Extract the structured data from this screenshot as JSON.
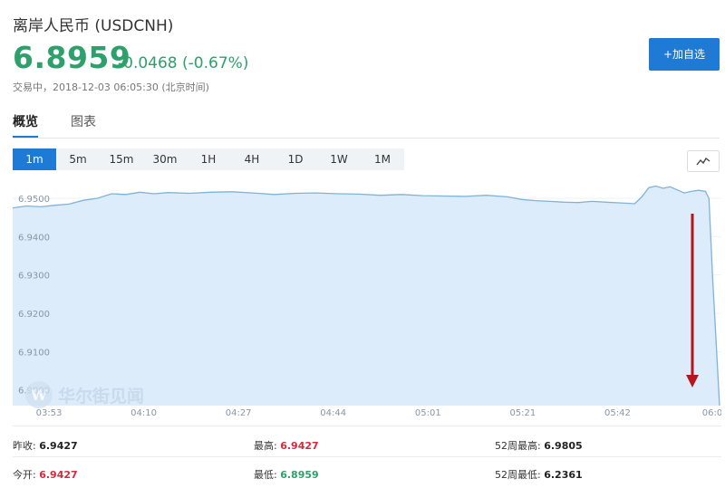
{
  "header": {
    "title": "离岸人民币 (USDCNH)",
    "price": "6.8959",
    "change": "-0.0468 (-0.67%)",
    "status": "交易中，2018-12-03 06:05:30 (北京时间)",
    "add_button": "+加自选"
  },
  "tabs": [
    {
      "label": "概览",
      "active": true
    },
    {
      "label": "图表",
      "active": false
    }
  ],
  "ranges": [
    "1m",
    "5m",
    "15m",
    "30m",
    "1H",
    "4H",
    "1D",
    "1W",
    "1M"
  ],
  "active_range": "1m",
  "watermark": {
    "text": "华尔街见闻"
  },
  "stats": {
    "prev_close_label": "昨收:",
    "prev_close": "6.9427",
    "open_label": "今开:",
    "open": "6.9427",
    "high_label": "最高:",
    "high": "6.9427",
    "low_label": "最低:",
    "low": "6.8959",
    "w52_high_label": "52周最高:",
    "w52_high": "6.9805",
    "w52_low_label": "52周最低:",
    "w52_low": "6.2361"
  },
  "colors": {
    "up": "#d9283c",
    "down": "#2ea06b",
    "accent": "#1f7ad6",
    "area_fill": "#dcecfa",
    "area_line": "#7fb3d9",
    "arrow": "#b3161c"
  },
  "chart_data": {
    "type": "area",
    "yticks": [
      "6.9500",
      "6.9400",
      "6.9300",
      "6.9200",
      "6.9100",
      "6.9000"
    ],
    "xticks": [
      "03:53",
      "04:10",
      "04:27",
      "04:44",
      "05:01",
      "05:21",
      "05:42",
      "06:0"
    ],
    "ylim": [
      6.8959,
      6.9545
    ],
    "x": [
      0,
      0.02,
      0.04,
      0.06,
      0.08,
      0.1,
      0.12,
      0.14,
      0.16,
      0.18,
      0.2,
      0.22,
      0.25,
      0.28,
      0.31,
      0.34,
      0.37,
      0.4,
      0.43,
      0.46,
      0.49,
      0.52,
      0.55,
      0.58,
      0.61,
      0.64,
      0.67,
      0.7,
      0.72,
      0.74,
      0.76,
      0.78,
      0.8,
      0.82,
      0.84,
      0.86,
      0.87,
      0.88,
      0.89,
      0.9,
      0.91,
      0.92,
      0.93,
      0.94,
      0.95,
      0.96,
      0.97,
      0.98,
      0.985,
      0.99,
      1.0
    ],
    "y": [
      6.9475,
      6.948,
      6.9478,
      6.9482,
      6.9485,
      6.9495,
      6.95,
      6.9512,
      6.951,
      6.9516,
      6.9512,
      6.9515,
      6.9513,
      6.9516,
      6.9517,
      6.9514,
      6.951,
      6.9513,
      6.9514,
      6.9512,
      6.9511,
      6.9508,
      6.951,
      6.9507,
      6.9506,
      6.9505,
      6.9508,
      6.9504,
      6.9497,
      6.9494,
      6.9492,
      6.949,
      6.9489,
      6.9492,
      6.949,
      6.9488,
      6.9487,
      6.9486,
      6.9504,
      6.9528,
      6.9532,
      6.9526,
      6.953,
      6.9522,
      6.9514,
      6.9518,
      6.9521,
      6.9518,
      6.95,
      6.93,
      6.8959
    ],
    "annotation": {
      "type": "arrow",
      "direction": "down"
    }
  }
}
